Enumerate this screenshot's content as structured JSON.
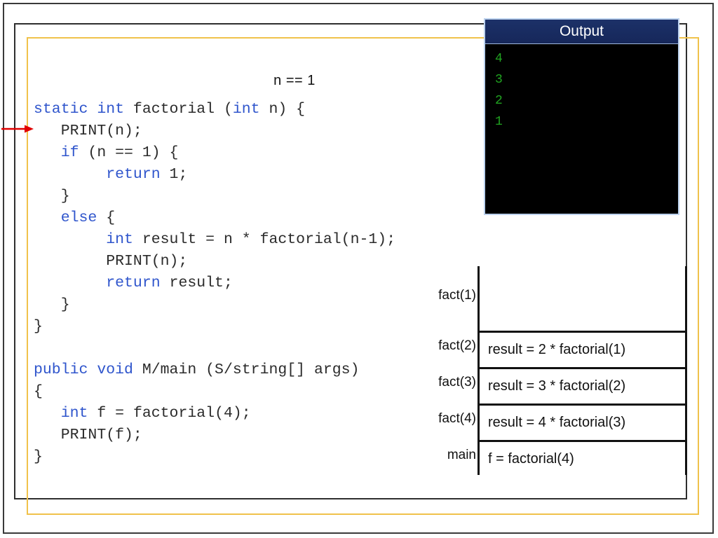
{
  "slide": {
    "condition_label": "n == 1"
  },
  "code": {
    "lines": [
      [
        {
          "t": "static int",
          "k": true
        },
        {
          "t": " factorial (",
          "k": false
        },
        {
          "t": "int",
          "k": true
        },
        {
          "t": " n) {",
          "k": false
        }
      ],
      [
        {
          "t": "   PRINT(n);",
          "k": false
        }
      ],
      [
        {
          "t": "   ",
          "k": false
        },
        {
          "t": "if",
          "k": true
        },
        {
          "t": " (n == 1) {",
          "k": false
        }
      ],
      [
        {
          "t": "        ",
          "k": false
        },
        {
          "t": "return",
          "k": true
        },
        {
          "t": " 1;",
          "k": false
        }
      ],
      [
        {
          "t": "   }",
          "k": false
        }
      ],
      [
        {
          "t": "   ",
          "k": false
        },
        {
          "t": "else",
          "k": true
        },
        {
          "t": " {",
          "k": false
        }
      ],
      [
        {
          "t": "        ",
          "k": false
        },
        {
          "t": "int",
          "k": true
        },
        {
          "t": " result = n * factorial(n-1);",
          "k": false
        }
      ],
      [
        {
          "t": "        PRINT(n);",
          "k": false
        }
      ],
      [
        {
          "t": "        ",
          "k": false
        },
        {
          "t": "return",
          "k": true
        },
        {
          "t": " result;",
          "k": false
        }
      ],
      [
        {
          "t": "   }",
          "k": false
        }
      ],
      [
        {
          "t": "}",
          "k": false
        }
      ],
      [
        {
          "t": "",
          "k": false
        }
      ],
      [
        {
          "t": "public void",
          "k": true
        },
        {
          "t": " M/main (S/string[] args)",
          "k": false
        }
      ],
      [
        {
          "t": "{",
          "k": false
        }
      ],
      [
        {
          "t": "   ",
          "k": false
        },
        {
          "t": "int",
          "k": true
        },
        {
          "t": " f = factorial(4);",
          "k": false
        }
      ],
      [
        {
          "t": "   PRINT(f);",
          "k": false
        }
      ],
      [
        {
          "t": "}",
          "k": false
        }
      ]
    ]
  },
  "output": {
    "title": "Output",
    "lines": [
      "4",
      "3",
      "2",
      "1"
    ]
  },
  "call_stack": {
    "rows": [
      {
        "label": "fact(1)",
        "expr": "",
        "empty": true
      },
      {
        "label": "fact(2)",
        "expr": "result = 2 * factorial(1)",
        "empty": false
      },
      {
        "label": "fact(3)",
        "expr": "result = 3 * factorial(2)",
        "empty": false
      },
      {
        "label": "fact(4)",
        "expr": "result = 4 * factorial(3)",
        "empty": false
      },
      {
        "label": "main",
        "expr": "f = factorial(4)",
        "empty": false
      }
    ]
  },
  "icons": {
    "execution_arrow": "red-right-arrow-icon"
  },
  "colors": {
    "keyword_blue": "#2f55cc",
    "code_text": "#2b2b2b",
    "highlight_frame": "#f0c24b",
    "inner_frame": "#2e2e2e",
    "console_background": "#000000",
    "console_text_green": "#21a521",
    "console_titlebar": "#1b2f63",
    "arrow_red": "#e00000"
  }
}
